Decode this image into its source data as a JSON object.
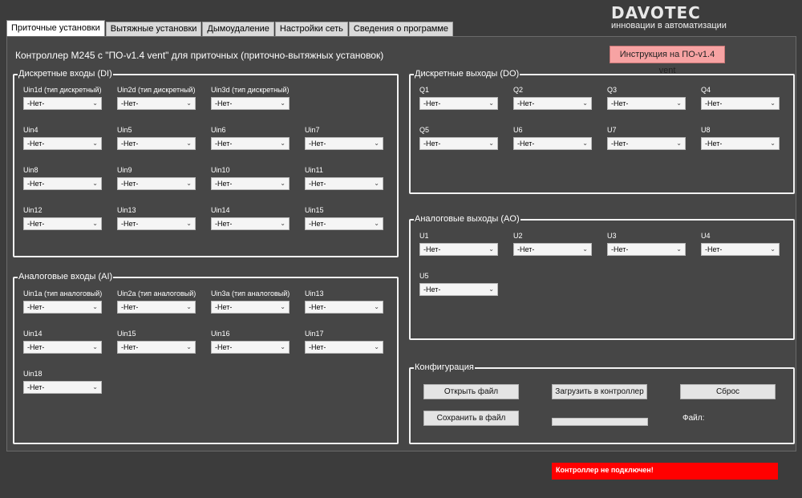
{
  "logo": {
    "brand": "DAVOTEC",
    "tagline": "инновации в автоматизации"
  },
  "tabs": [
    {
      "label": "Приточные установки",
      "active": true
    },
    {
      "label": "Вытяжные установки",
      "active": false
    },
    {
      "label": "Дымоудаление",
      "active": false
    },
    {
      "label": "Настройки сеть",
      "active": false
    },
    {
      "label": "Сведения о программе",
      "active": false
    }
  ],
  "controller_title": "Контроллер M245 с \"ПО-v1.4 vent\" для приточных (приточно-вытяжных установок)",
  "instruction_button": "Инструкция на ПО-v1.4 vent",
  "di": {
    "title": "Дискретные входы (DI)",
    "fields": [
      {
        "label": "Uin1d (тип дискретный)",
        "value": "-Нет-"
      },
      {
        "label": "Uin2d (тип дискретный)",
        "value": "-Нет-"
      },
      {
        "label": "Uin3d (тип дискретный)",
        "value": "-Нет-"
      },
      {
        "label": "Uin4",
        "value": "-Нет-"
      },
      {
        "label": "Uin5",
        "value": "-Нет-"
      },
      {
        "label": "Uin6",
        "value": "-Нет-"
      },
      {
        "label": "Uin7",
        "value": "-Нет-"
      },
      {
        "label": "Uin8",
        "value": "-Нет-"
      },
      {
        "label": "Uin9",
        "value": "-Нет-"
      },
      {
        "label": "Uin10",
        "value": "-Нет-"
      },
      {
        "label": "Uin11",
        "value": "-Нет-"
      },
      {
        "label": "Uin12",
        "value": "-Нет-"
      },
      {
        "label": "Uin13",
        "value": "-Нет-"
      },
      {
        "label": "Uin14",
        "value": "-Нет-"
      },
      {
        "label": "Uin15",
        "value": "-Нет-"
      }
    ]
  },
  "ai": {
    "title": "Аналоговые входы (AI)",
    "fields": [
      {
        "label": "Uin1a (тип аналоговый)",
        "value": "-Нет-"
      },
      {
        "label": "Uin2a (тип аналоговый)",
        "value": "-Нет-"
      },
      {
        "label": "Uin3a (тип аналоговый)",
        "value": "-Нет-"
      },
      {
        "label": "Uin13",
        "value": "-Нет-"
      },
      {
        "label": "Uin14",
        "value": "-Нет-"
      },
      {
        "label": "Uin15",
        "value": "-Нет-"
      },
      {
        "label": "Uin16",
        "value": "-Нет-"
      },
      {
        "label": "Uin17",
        "value": "-Нет-"
      },
      {
        "label": "Uin18",
        "value": "-Нет-"
      }
    ]
  },
  "do": {
    "title": "Дискретные выходы (DO)",
    "fields": [
      {
        "label": "Q1",
        "value": "-Нет-"
      },
      {
        "label": "Q2",
        "value": "-Нет-"
      },
      {
        "label": "Q3",
        "value": "-Нет-"
      },
      {
        "label": "Q4",
        "value": "-Нет-"
      },
      {
        "label": "Q5",
        "value": "-Нет-"
      },
      {
        "label": "U6",
        "value": "-Нет-"
      },
      {
        "label": "U7",
        "value": "-Нет-"
      },
      {
        "label": "U8",
        "value": "-Нет-"
      }
    ]
  },
  "ao": {
    "title": "Аналоговые выходы (AO)",
    "fields": [
      {
        "label": "U1",
        "value": "-Нет-"
      },
      {
        "label": "U2",
        "value": "-Нет-"
      },
      {
        "label": "U3",
        "value": "-Нет-"
      },
      {
        "label": "U4",
        "value": "-Нет-"
      },
      {
        "label": "U5",
        "value": "-Нет-"
      }
    ]
  },
  "config": {
    "title": "Конфигурация",
    "open_file": "Открыть файл",
    "upload": "Загрузить в контроллер",
    "reset": "Сброс",
    "save_file": "Сохранить в файл",
    "file_label": "Файл:",
    "progress": 0
  },
  "status": {
    "text": "Контроллер не подключен!",
    "color": "#ff0000"
  },
  "icons": {
    "dropdown": "chevron-down-icon"
  }
}
